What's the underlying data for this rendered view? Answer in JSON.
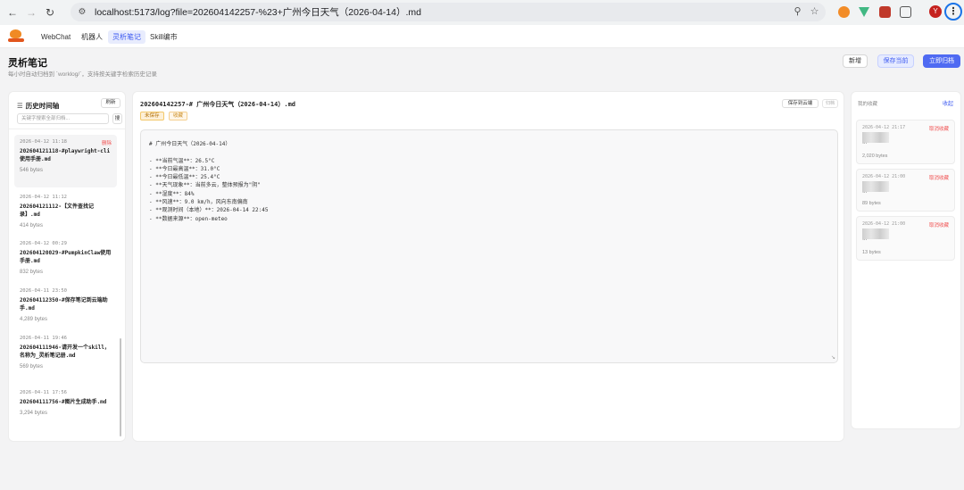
{
  "browser": {
    "url": "localhost:5173/log?file=202604142257-%23+广州今日天气（2026-04-14）.md",
    "profile_initial": "Y"
  },
  "nav": {
    "items": [
      "WebChat",
      "机器人",
      "灵析笔记",
      "Skill编市"
    ],
    "active_index": 2
  },
  "header": {
    "title": "灵析笔记",
    "subtitle": "每小时自动归档到 `worklog/`，支持按关键字检索历史记录",
    "new_label": "新增",
    "save_current_label": "保存当前",
    "archive_now_label": "立即归档"
  },
  "history": {
    "title": "历史时间轴",
    "refresh_label": "刷新",
    "search_placeholder": "关键字搜索全部归档...",
    "search_label": "搜",
    "delete_label": "删除",
    "items": [
      {
        "date": "2026-04-12 11:18",
        "name": "202604121118-#playwright-cli 使用手册.md",
        "size": "546 bytes"
      },
      {
        "date": "2026-04-12 11:12",
        "name": "202604121112-【文件查找记录】.md",
        "size": "414 bytes"
      },
      {
        "date": "2026-04-12 00:29",
        "name": "202604120029-#PumpkinClaw使用手册.md",
        "size": "832 bytes"
      },
      {
        "date": "2026-04-11 23:50",
        "name": "202604112350-#保存笔记到云端助手.md",
        "size": "4,289 bytes"
      },
      {
        "date": "2026-04-11 19:46",
        "name": "202604111946-请开发一个skill，名称为_灵析笔记册.md",
        "size": "569 bytes"
      },
      {
        "date": "2026-04-11 17:56",
        "name": "202604111756-#图片生成助手.md",
        "size": "3,294 bytes"
      }
    ]
  },
  "editor": {
    "file_title": "202604142257-# 广州今日天气（2026-04-14）.md",
    "tag_unsaved": "未保存",
    "tag_fav": "收藏",
    "save_cloud_label": "保存到云端",
    "more_label": "归档",
    "lines": [
      "# 广州今日天气（2026-04-14）",
      "",
      "- **当前气温**：26.5°C",
      "- **今日最高温**：31.0°C",
      "- **今日最低温**：25.4°C",
      "- **天气现象**：当前多云，整体预报为\"阴\"",
      "- **湿度**：84%",
      "- **风速**：9.0 km/h，风向东南偏南",
      "- **观测时间（本地）**：2026-04-14 22:45",
      "- **数据来源**：open-meteo"
    ]
  },
  "favorites": {
    "title": "我的收藏",
    "collapse_label": "收起",
    "cancel_label": "取消收藏",
    "items": [
      {
        "date": "2026-04-12 21:17",
        "title": "…",
        "size": "2,020 bytes"
      },
      {
        "date": "2026-04-12 21:00",
        "title": "…",
        "size": "89 bytes"
      },
      {
        "date": "2026-04-12 21:00",
        "title": "…",
        "size": "13 bytes"
      }
    ]
  }
}
